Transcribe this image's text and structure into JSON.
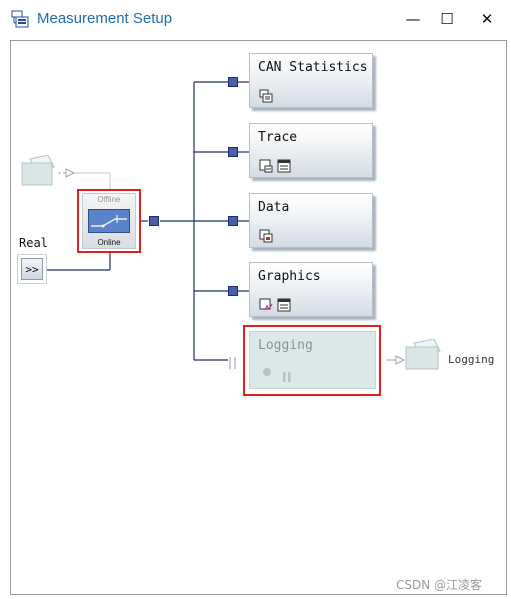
{
  "window": {
    "title": "Measurement Setup",
    "minimize_glyph": "—",
    "maximize_glyph": "☐",
    "close_glyph": "✕"
  },
  "source": {
    "real_label": "Real",
    "real_button_glyph": ">>"
  },
  "switch": {
    "offline_label": "Offline",
    "online_label": "Online"
  },
  "blocks": [
    {
      "label": "CAN Statistics"
    },
    {
      "label": "Trace"
    },
    {
      "label": "Data"
    },
    {
      "label": "Graphics"
    },
    {
      "label": "Logging"
    }
  ],
  "logging_output": {
    "label": "Logging"
  },
  "watermark": "CSDN @江凌客",
  "colors": {
    "title": "#1f6bb5",
    "wire": "#1d2c6a",
    "node": "#4a5ea8",
    "highlight": "#e02020",
    "disabled_block": "#dce7e7"
  }
}
